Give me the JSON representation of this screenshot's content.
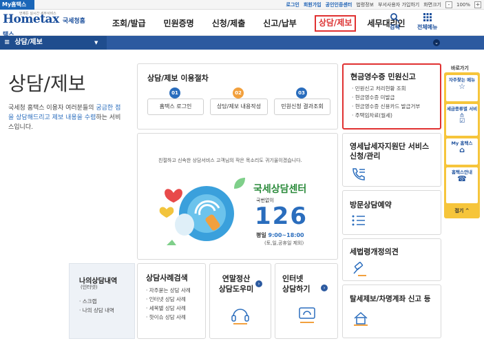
{
  "topbar": {
    "my_tab": "My홈택스",
    "links": [
      "로그인",
      "회원가입",
      "공인인증센터",
      "법령정보",
      "부서사용자 가입하기",
      "화면크기"
    ],
    "zoom": "100%",
    "zoom_minus": "-",
    "zoom_plus": "+"
  },
  "logo": {
    "main": "Hometax",
    "sub": "국세청홈택스",
    "tagline": "언제든 실시간 세무서비스"
  },
  "gnb": {
    "items": [
      "조회/발급",
      "민원증명",
      "신청/제출",
      "신고/납부",
      "상담/제보",
      "세무대리인"
    ],
    "search": "검색",
    "all_menu": "전체메뉴"
  },
  "bluebar": {
    "menu_label": "상담/제보"
  },
  "left": {
    "title": "상담/제보",
    "desc_before": "국세청 홈택스 이용자 여러분들의 ",
    "desc_highlight1": "궁금한 점을 상담해드리고 제보 내용을 수렴",
    "desc_after": "하는 서비스입니다.",
    "mycase_title": "나의상담내역",
    "mycase_sub": "(인터넷)",
    "mycase_items": [
      "스크랩",
      "나의 상담 내역"
    ]
  },
  "procedure": {
    "title": "상담/제보 이용절차",
    "steps": [
      {
        "num": "01",
        "label": "홈택스 로그인",
        "color": "#2a6dbd"
      },
      {
        "num": "02",
        "label": "상담/제보 내용작성",
        "color": "#f2a03d"
      },
      {
        "num": "03",
        "label": "민원신청 결과조회",
        "color": "#2a6dbd"
      }
    ]
  },
  "cash_receipt": {
    "title": "현금영수증 민원신고",
    "items": [
      "민원신고 처리현황 조회",
      "현금영수증 미발급",
      "현금영수증 신용카드 발급거부",
      "주택임차료(월세)"
    ]
  },
  "banner": {
    "intro": "친절하고 신속한 상담서비스 고객님의 작은 목소리도 귀기울이겠습니다.",
    "center_name": "국세상담센터",
    "no_area": "국번없이",
    "number": "126",
    "hours_label": "평일",
    "hours": "9:00~18:00",
    "hours_note": "(토,일,공휴일 제외)"
  },
  "right_cards": [
    {
      "title": "영세납세자지원단 서비스 신청/관리"
    },
    {
      "title": "방문상담예약"
    },
    {
      "title": "세법령개정의견"
    },
    {
      "title": "탈세제보/차명계좌 신고 등"
    }
  ],
  "case_search": {
    "title": "상담사례검색",
    "items": [
      "자주묻는 상담 사례",
      "인터넷 상담 사례",
      "세목별 상담 사례",
      "핫이슈 상담 사례"
    ]
  },
  "yearend": {
    "line1": "연말정산",
    "line2": "상담도우미"
  },
  "internet": {
    "line1": "인터넷",
    "line2": "상담하기"
  },
  "aside": {
    "title": "바로가기",
    "items": [
      "자주찾는 메뉴",
      "세금종류별 서비스",
      "My 홈택스",
      "홈택스안내"
    ],
    "fold": "접기"
  }
}
